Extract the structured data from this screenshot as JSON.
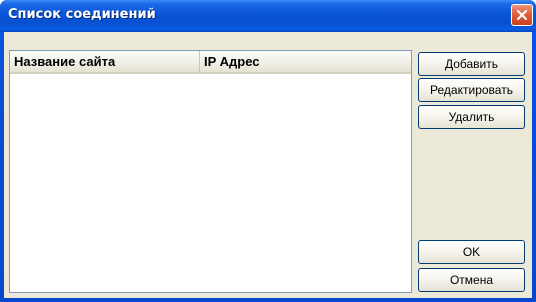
{
  "window": {
    "title": "Список соединений"
  },
  "list": {
    "columns": [
      "Название сайта",
      "IP Адрес"
    ],
    "rows": []
  },
  "buttons": {
    "add": "Добавить",
    "edit": "Редактировать",
    "delete": "Удалить",
    "ok": "OK",
    "cancel": "Отмена"
  },
  "icons": {
    "close": "close-icon"
  },
  "colors": {
    "titlebar": "#0a56d8",
    "dialog_face": "#ece9d8",
    "close_button": "#e0603c"
  }
}
